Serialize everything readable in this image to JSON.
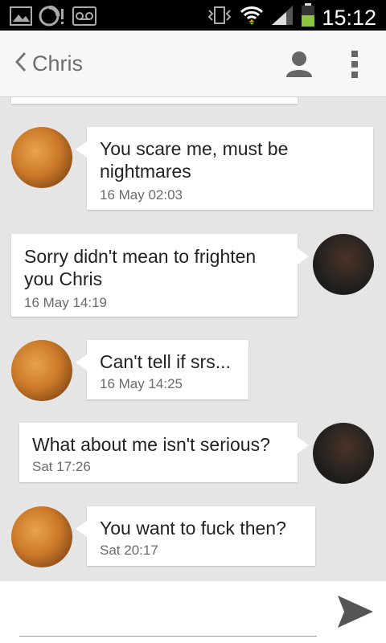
{
  "status_bar": {
    "time": "15:12",
    "icons": [
      "gallery-icon",
      "sync-alert-icon",
      "voicemail-icon",
      "vibrate-icon",
      "wifi-icon",
      "signal-icon",
      "battery-icon"
    ]
  },
  "header": {
    "title": "Chris",
    "back_icon": "chevron-left-icon",
    "contact_icon": "person-icon",
    "menu_icon": "overflow-menu-icon"
  },
  "messages": [
    {
      "from": "Chris",
      "text": "You scare me, must be nightmares",
      "time": "16 May  02:03"
    },
    {
      "from": "me",
      "text": "Sorry didn't mean to frighten you Chris",
      "time": "16 May  14:19"
    },
    {
      "from": "Chris",
      "text": "Can't tell if srs...",
      "time": "16 May  14:25"
    },
    {
      "from": "me",
      "text": "What about me isn't serious?",
      "time": "Sat  17:26"
    },
    {
      "from": "Chris",
      "text": "You want to fuck then?",
      "time": "Sat  20:17"
    }
  ],
  "composer": {
    "value": "",
    "placeholder": "",
    "send_icon": "send-icon"
  },
  "colors": {
    "background": "#e5e5e5",
    "bubble": "#ffffff",
    "status_bar": "#000000",
    "battery": "#8cc63f"
  }
}
